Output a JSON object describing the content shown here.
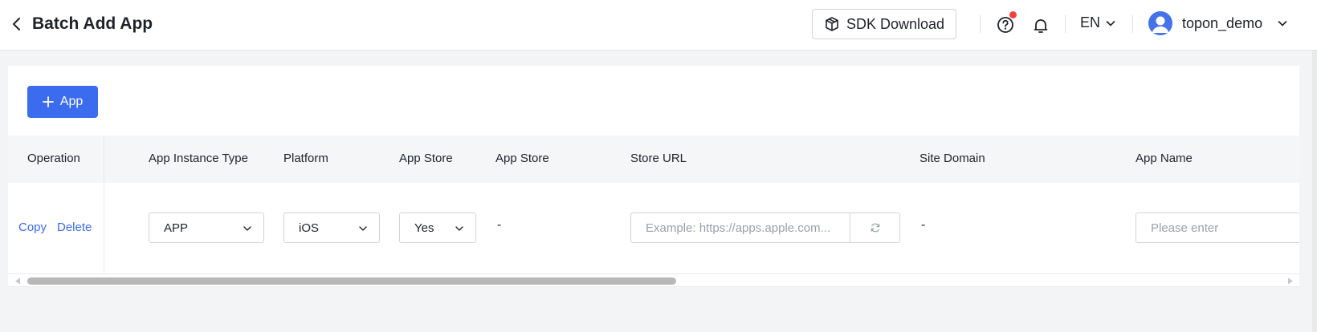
{
  "header": {
    "title": "Batch Add App",
    "sdk_download_label": "SDK Download",
    "language": "EN",
    "username": "topon_demo"
  },
  "toolbar": {
    "add_app_label": "App"
  },
  "table": {
    "columns": {
      "operation": "Operation",
      "app_instance_type": "App Instance Type",
      "platform": "Platform",
      "app_store": "App Store",
      "app_store_2": "App Store",
      "store_url": "Store URL",
      "site_domain": "Site Domain",
      "app_name": "App Name"
    },
    "rows": [
      {
        "copy_label": "Copy",
        "delete_label": "Delete",
        "app_instance_type": "APP",
        "platform": "iOS",
        "app_store": "Yes",
        "app_store_value": "-",
        "store_url_placeholder": "Example: https://apps.apple.com...",
        "site_domain": "-",
        "app_name_placeholder": "Please enter"
      }
    ]
  },
  "colors": {
    "primary": "#3b6cf0",
    "notification_dot": "#f53f3f",
    "page_background": "#f3f4f6"
  }
}
